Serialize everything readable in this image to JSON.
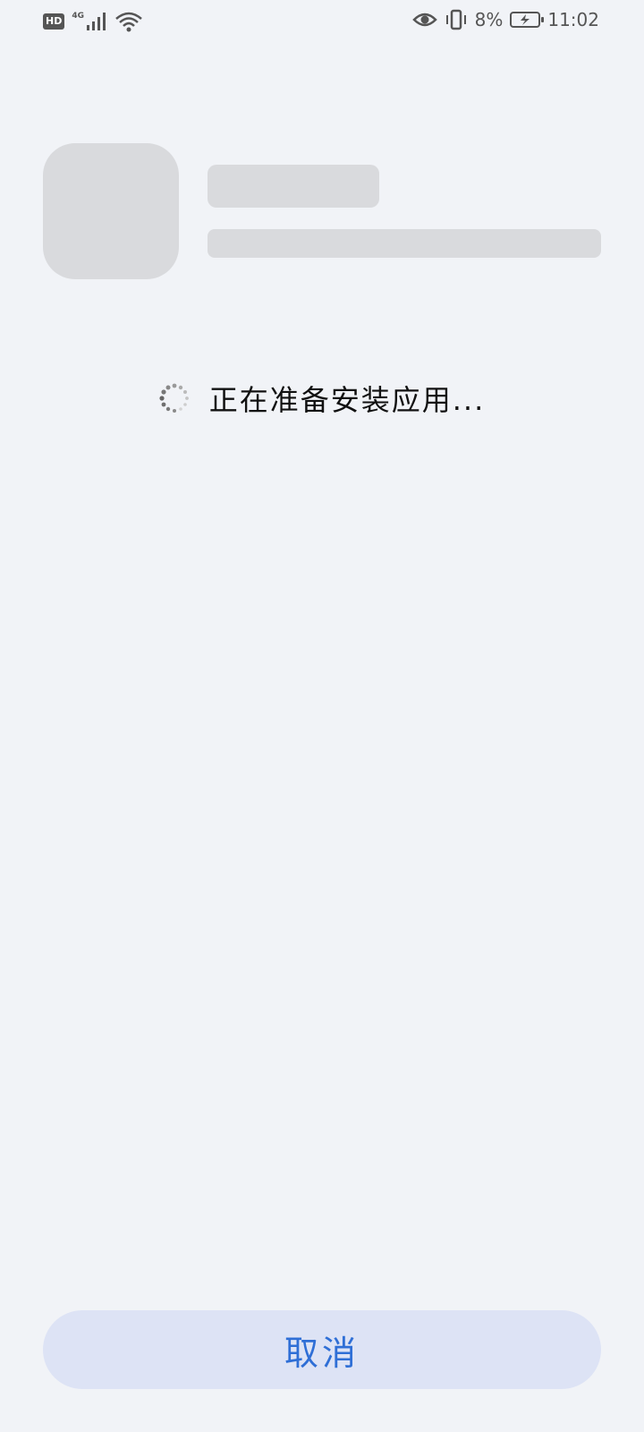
{
  "status_bar": {
    "hd": "HD",
    "network": "4G",
    "battery_percent": "8%",
    "time": "11:02"
  },
  "install": {
    "loading_text": "正在准备安装应用..."
  },
  "actions": {
    "cancel_label": "取消"
  },
  "colors": {
    "background": "#f1f3f7",
    "placeholder": "#d9dadd",
    "button_bg": "#dde3f5",
    "accent": "#2f6fd6"
  },
  "icons": [
    "signal-icon",
    "wifi-icon",
    "eye-icon",
    "vibrate-icon",
    "battery-charging-icon",
    "loading-spinner-icon"
  ]
}
